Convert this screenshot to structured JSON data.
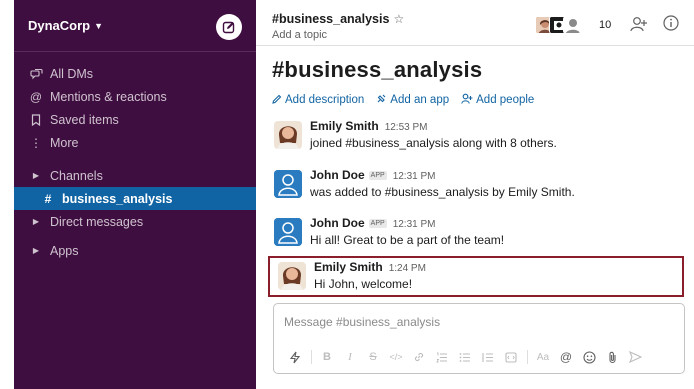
{
  "workspace": {
    "name": "DynaCorp",
    "chevron": "⌄"
  },
  "sidebar": {
    "items": [
      {
        "id": "all-dms",
        "icon": "dms-icon",
        "label": "All DMs"
      },
      {
        "id": "mentions",
        "icon": "at-icon",
        "label": "Mentions & reactions"
      },
      {
        "id": "saved",
        "icon": "bookmark-icon",
        "label": "Saved items"
      },
      {
        "id": "more",
        "icon": "more-icon",
        "label": "More"
      }
    ],
    "sections": {
      "channels": "Channels",
      "channel_item": "business_analysis",
      "direct_messages": "Direct messages",
      "apps": "Apps"
    }
  },
  "channel": {
    "name": "#business_analysis",
    "topic": "Add a topic",
    "member_count": "10",
    "big_title": "#business_analysis",
    "actions": {
      "add_description": "Add description",
      "add_app": "Add an app",
      "add_people": "Add people"
    }
  },
  "messages": [
    {
      "author": "Emily Smith",
      "badge": "",
      "time": "12:53 PM",
      "text": "joined #business_analysis along with 8 others."
    },
    {
      "author": "John Doe",
      "badge": "APP",
      "time": "12:31 PM",
      "text": "was added to #business_analysis by Emily Smith."
    },
    {
      "author": "John Doe",
      "badge": "APP",
      "time": "12:31 PM",
      "text": "Hi all! Great to be a part of the team!"
    },
    {
      "author": "Emily Smith",
      "badge": "",
      "time": "1:24 PM",
      "text": "Hi John, welcome!"
    }
  ],
  "composer": {
    "placeholder": "Message #business_analysis"
  },
  "colors": {
    "sidebar_bg": "#3f0e40",
    "selected": "#1164a3",
    "link": "#1264a3",
    "highlight_border": "#8b1e2b"
  }
}
